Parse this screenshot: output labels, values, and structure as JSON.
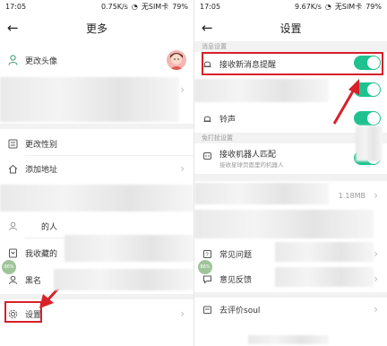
{
  "left": {
    "status": {
      "time": "17:05",
      "speed": "0.75K/s",
      "sim": "无SIM卡",
      "battery": "79%"
    },
    "title": "更多",
    "items": {
      "avatar": "更改头像",
      "gender": "更改性别",
      "address": "添加地址",
      "people": "的人",
      "my_collection": "我收藏的",
      "black": "黑名",
      "settings": "设置"
    },
    "badge": "86%"
  },
  "right": {
    "status": {
      "time": "17:05",
      "speed": "9.67K/s",
      "sim": "无SIM卡",
      "battery": "79%"
    },
    "title": "设置",
    "section_message": "消息设置",
    "section_disturb": "免打扰设置",
    "items": {
      "notify": "接收新消息提醒",
      "ringtone": "铃声",
      "robot": "接收机器人匹配",
      "robot_sub": "接收星球页面里的机器人",
      "cache_size": "1.18MB",
      "faq": "常见问题",
      "feedback": "意见反馈",
      "rate": "去评价soul"
    },
    "badge": "86%"
  },
  "colors": {
    "accent": "#1fc28f",
    "highlight": "#d7202a"
  }
}
